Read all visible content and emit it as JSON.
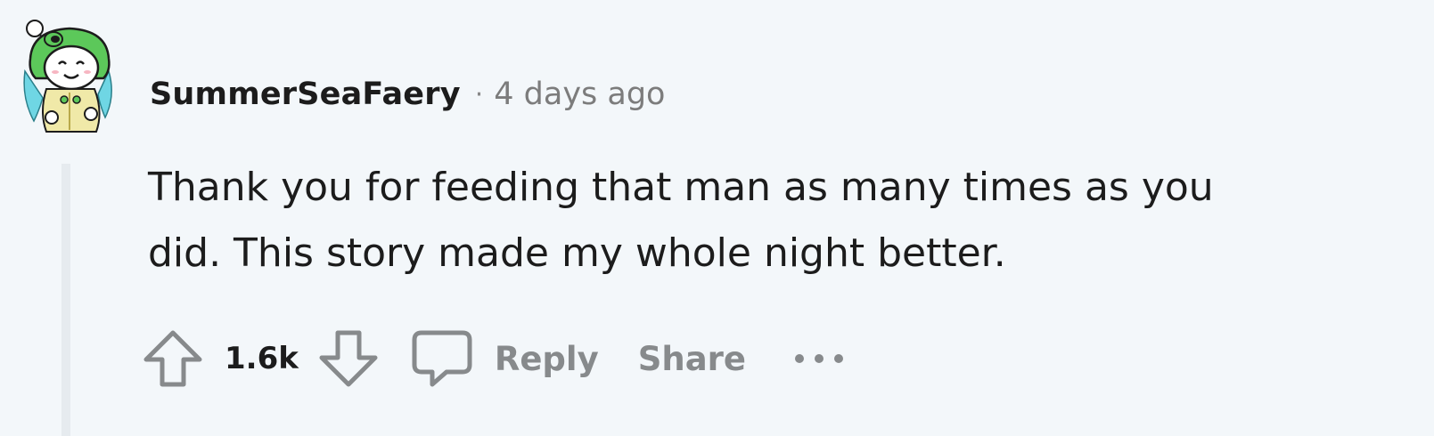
{
  "comment": {
    "author": "SummerSeaFaery",
    "separator": "·",
    "timestamp": "4 days ago",
    "body_lines": [
      "Thank you for feeding that man as many times as you",
      "did. This story made my whole night better."
    ],
    "score": "1.6k"
  },
  "actions": {
    "reply_label": "Reply",
    "share_label": "Share"
  },
  "colors": {
    "background": "#f3f7fa",
    "text": "#1c1c1c",
    "muted": "#878a8c",
    "avatar_green": "#5cc85a"
  },
  "icons": [
    "upvote-arrow-icon",
    "downvote-arrow-icon",
    "comment-bubble-icon",
    "more-options-icon"
  ]
}
